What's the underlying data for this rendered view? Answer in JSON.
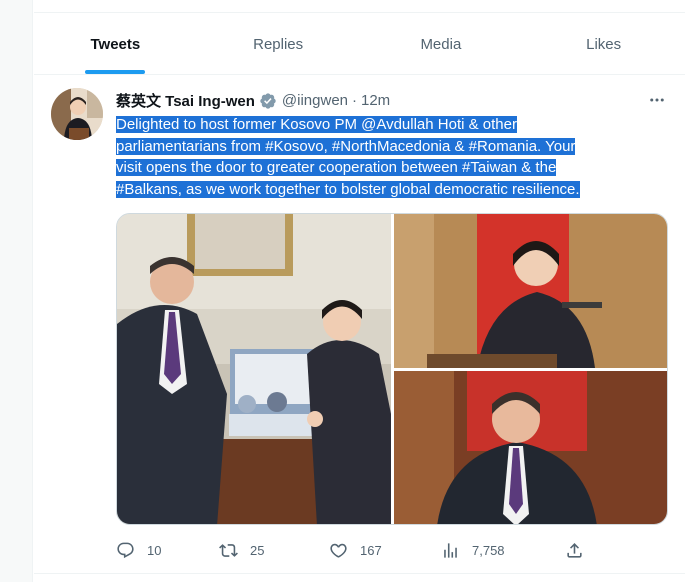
{
  "tabs": [
    {
      "label": "Tweets",
      "active": true
    },
    {
      "label": "Replies",
      "active": false
    },
    {
      "label": "Media",
      "active": false
    },
    {
      "label": "Likes",
      "active": false
    }
  ],
  "tweet": {
    "name": "蔡英文 Tsai Ing-wen",
    "handle": "@iingwen",
    "separator": "·",
    "time": "12m",
    "text_lines": [
      "Delighted to host former Kosovo PM @Avdullah Hoti & other",
      "parliamentarians from #Kosovo, #NorthMacedonia & #Romania. Your",
      "visit opens the door to greater cooperation between #Taiwan & the",
      "#Balkans, as we work together to bolster global democratic resilience."
    ],
    "stats": {
      "replies": "10",
      "retweets": "25",
      "likes": "167",
      "views": "7,758"
    }
  },
  "colors": {
    "accent": "#1d9bf0",
    "selection": "#1e71d6",
    "muted": "#536471"
  },
  "icons": {
    "verified": "verified-badge-icon",
    "more": "more-dots-icon",
    "reply": "reply-icon",
    "retweet": "retweet-icon",
    "like": "heart-icon",
    "views": "views-icon",
    "share": "share-icon"
  }
}
